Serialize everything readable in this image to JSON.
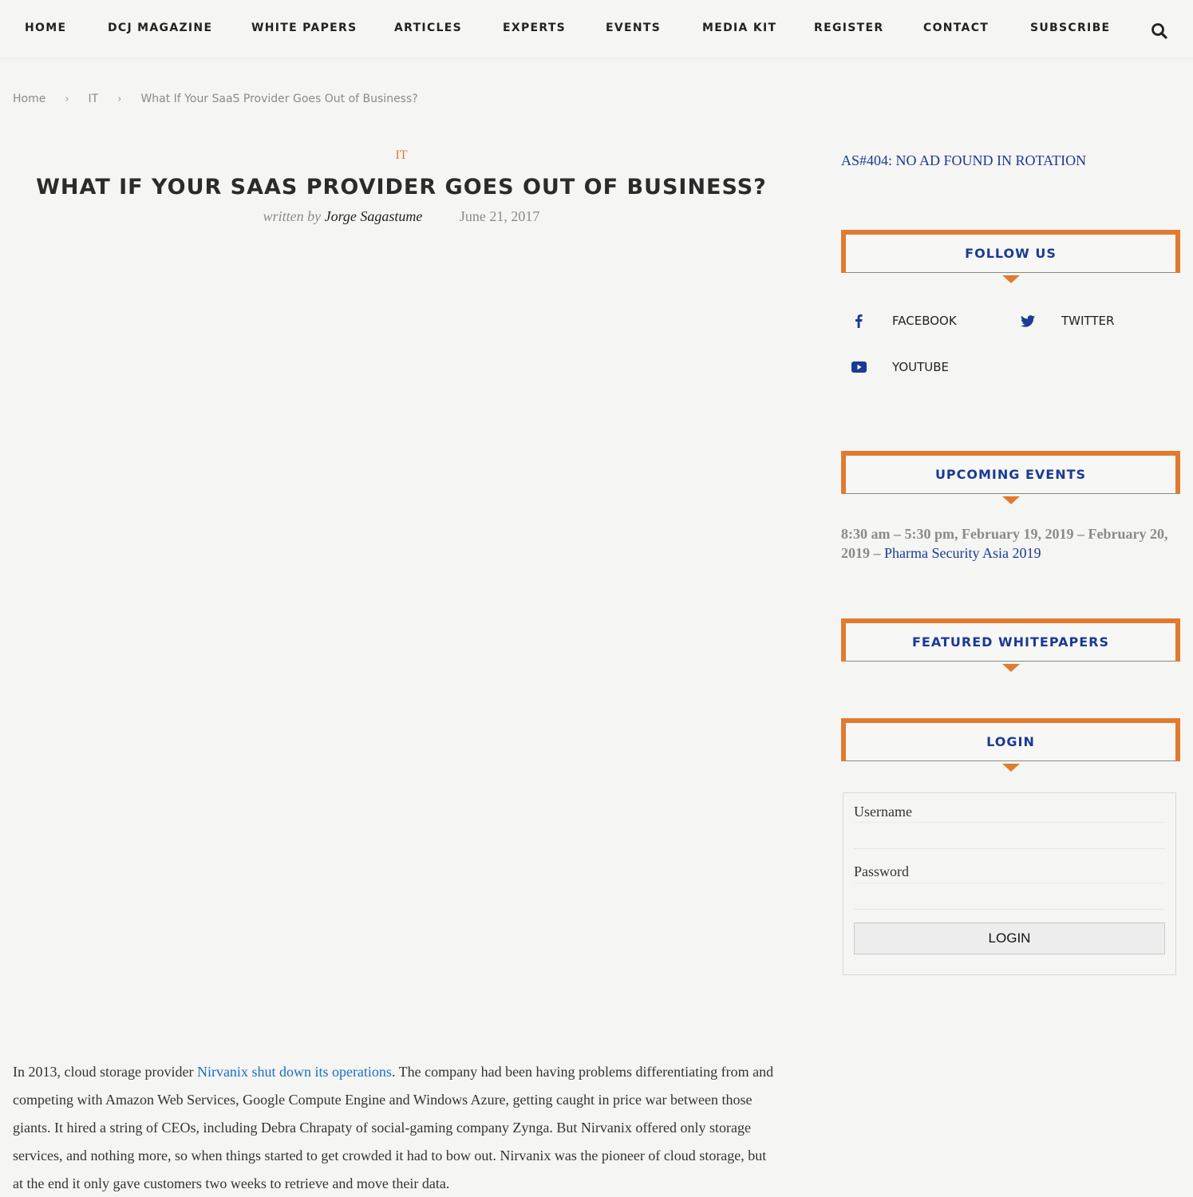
{
  "nav": {
    "items": [
      {
        "label": "HOME"
      },
      {
        "label": "DCJ MAGAZINE"
      },
      {
        "label": "WHITE PAPERS"
      },
      {
        "label": "ARTICLES"
      },
      {
        "label": "EXPERTS"
      },
      {
        "label": "EVENTS"
      },
      {
        "label": "MEDIA KIT"
      },
      {
        "label": "REGISTER"
      },
      {
        "label": "CONTACT"
      },
      {
        "label": "SUBSCRIBE"
      }
    ],
    "search_icon": "search-icon"
  },
  "breadcrumb": {
    "items": [
      "Home",
      "IT"
    ],
    "separator": "›",
    "current": "What If Your SaaS Provider Goes Out of Business?"
  },
  "article": {
    "category": "IT",
    "title": "WHAT IF YOUR SAAS PROVIDER GOES OUT OF BUSINESS?",
    "written_by": "written by",
    "author": "Jorge Sagastume",
    "date": "June 21, 2017",
    "body": {
      "intro": "In 2013, cloud storage provider ",
      "link": "Nirvanix shut down its operations",
      "rest": ". The company had been having problems differentiating from and competing with Amazon Web Services, Google Compute Engine and Windows Azure, getting caught in price war between those giants. It hired a string of CEOs, including Debra Chrapaty of social-gaming company Zynga. But Nirvanix offered only storage services, and nothing more, so when things started to get crowded it had to bow out. Nirvanix was the pioneer of cloud storage, but at the end it only gave customers two weeks to retrieve and move their data."
    }
  },
  "sidebar": {
    "ad_text": "AS#404: NO AD FOUND IN ROTATION",
    "follow_us": {
      "title": "FOLLOW US",
      "links": [
        {
          "label": "FACEBOOK",
          "icon": "facebook-icon"
        },
        {
          "label": "TWITTER",
          "icon": "twitter-icon"
        },
        {
          "label": "YOUTUBE",
          "icon": "youtube-icon"
        }
      ]
    },
    "upcoming_events": {
      "title": "UPCOMING EVENTS",
      "when": "8:30 am – 5:30 pm, February 19, 2019 – February 20, 2019 – ",
      "event_link": "Pharma Security Asia 2019"
    },
    "featured_whitepapers": {
      "title": "FEATURED WHITEPAPERS"
    },
    "login": {
      "title": "LOGIN",
      "username_label": "Username",
      "username_value": "",
      "password_label": "Password",
      "password_value": "",
      "button_label": "LOGIN"
    }
  },
  "colors": {
    "accent_orange": "#e07b2f",
    "heading_blue": "#1a3a94",
    "link_blue": "#1c6fc2",
    "background": "#f5f5f4"
  }
}
